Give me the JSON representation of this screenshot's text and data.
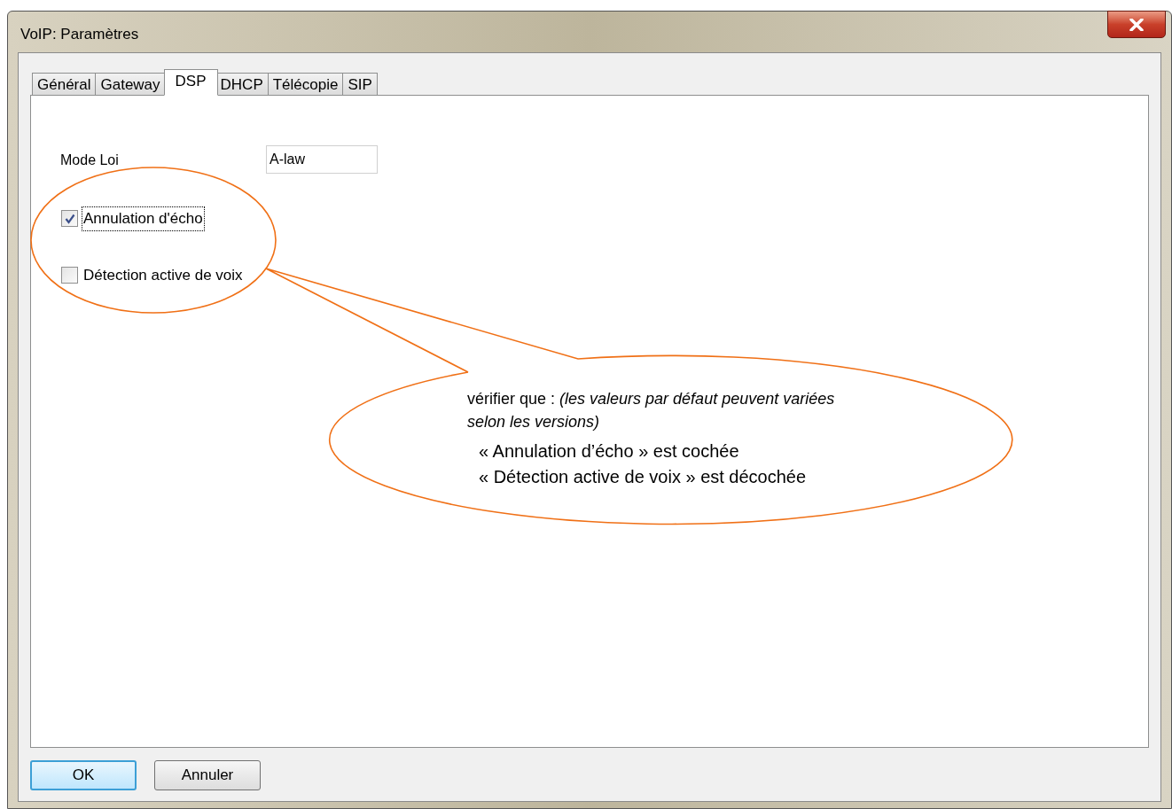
{
  "window": {
    "title": "VoIP: Paramètres"
  },
  "tabs": [
    {
      "label": "Général",
      "selected": false
    },
    {
      "label": "Gateway",
      "selected": false
    },
    {
      "label": "DSP",
      "selected": true
    },
    {
      "label": "DHCP",
      "selected": false
    },
    {
      "label": "Télécopie",
      "selected": false
    },
    {
      "label": "SIP",
      "selected": false
    }
  ],
  "mode_field": {
    "label": "Mode Loi",
    "value": "A-law"
  },
  "checkboxes": [
    {
      "label": "Annulation d'écho",
      "checked": true,
      "focused": true
    },
    {
      "label": "Détection active de voix",
      "checked": false,
      "focused": false
    }
  ],
  "callout": {
    "intro": "vérifier que : *(les valeurs par défaut peuvent variées selon les versions)*",
    "lines": [
      "« Annulation d’écho » est cochée",
      "« Détection active de voix » est décochée"
    ]
  },
  "buttons": [
    {
      "label": "OK",
      "default": true
    },
    {
      "label": "Annuler",
      "default": false
    }
  ]
}
